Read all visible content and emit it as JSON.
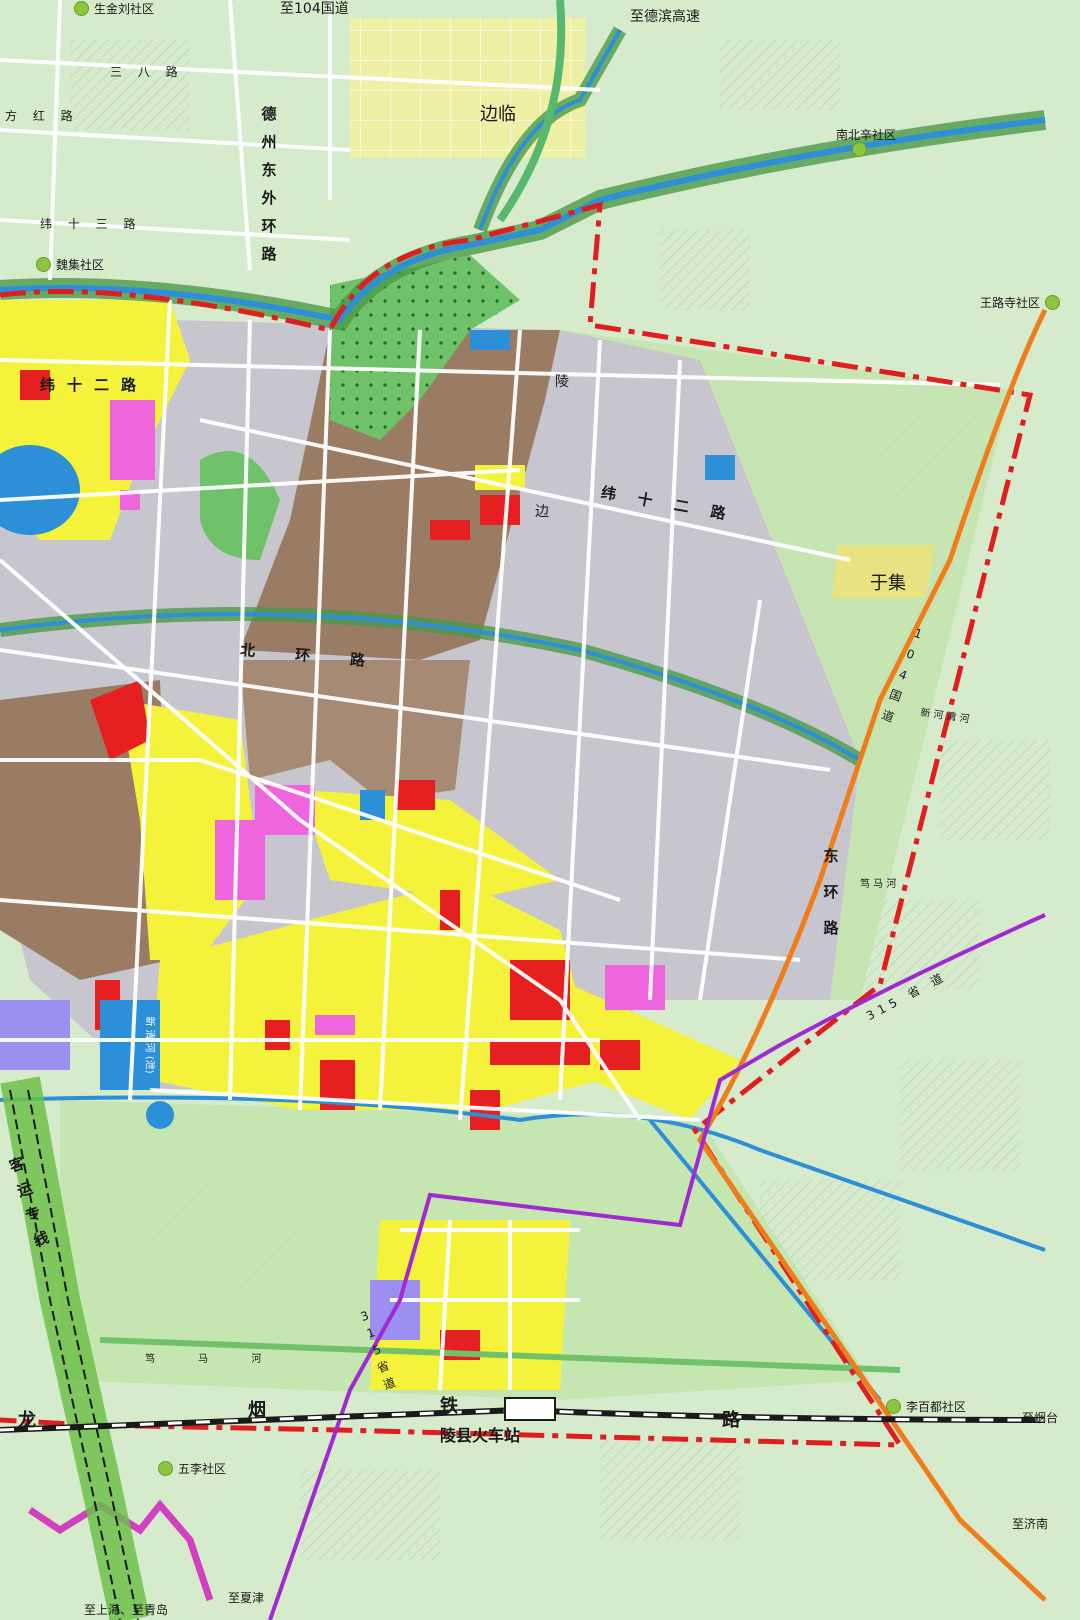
{
  "colors": {
    "background": "#d9ecd0",
    "agri_green": "#cde8c2",
    "park_green": "#9ad58a",
    "greenbelt": "#66bb6a",
    "water": "#2c8fd8",
    "residential": "#f5f23c",
    "industrial": "#9a7b63",
    "commercial": "#e62020",
    "public": "#ee66dd",
    "village": "#c8c6cf",
    "boundary": "#e01e1e",
    "highway": "#f07d1c",
    "province_road": "#a02ad0",
    "railway": "#1a1a1a",
    "countryside": "#eef3a8"
  },
  "labels": {
    "top_road": "至104国道",
    "top_right_exit": "至德滨高速",
    "bianlin": "边临",
    "yuji": "于集",
    "dezhou_ring": [
      "德",
      "州",
      "东",
      "外",
      "环",
      "路"
    ],
    "wei12_west": [
      "纬",
      "十",
      "二",
      "路"
    ],
    "wei12_east": [
      "纬",
      "十",
      "二",
      "路"
    ],
    "san_ba_road": "三 八 路",
    "fang_hong_road": "方 红 路",
    "wei_13_road": "纬 十 三 路",
    "north_ring": [
      "北",
      "环",
      "路"
    ],
    "ling_road": "陵",
    "bian_road": "边",
    "national_104": [
      "1",
      "0",
      "4",
      "国",
      "道"
    ],
    "east_ring": [
      "东",
      "环",
      "路"
    ],
    "province_315": "315 省 道",
    "province_315_south": [
      "3",
      "1",
      "5",
      "省",
      "道"
    ],
    "xin_river": "新 河 清 河",
    "ma_river": "笃 马 河",
    "ma_river_south": "笃 马 河",
    "rail_long": "龙",
    "rail_yan": "烟",
    "rail_tie": "铁",
    "rail_lu": "路",
    "station": "陵县火车站",
    "passenger_line": [
      "客",
      "运",
      "专",
      "线"
    ],
    "to_yantai": "至烟台",
    "to_jinan": "至济南",
    "to_xiajin": "至夏津",
    "to_shanghai": "至上海、至青岛",
    "canal_label": "新 清 河 (泄)"
  },
  "communities": [
    {
      "name": "生金刘社区",
      "key": "shengjinliu"
    },
    {
      "name": "南北辛社区",
      "key": "nanbeixin"
    },
    {
      "name": "魏集社区",
      "key": "weiji"
    },
    {
      "name": "王路寺社区",
      "key": "wanglusi"
    },
    {
      "name": "李百都社区",
      "key": "libaidu"
    },
    {
      "name": "五李社区",
      "key": "wuli"
    }
  ]
}
